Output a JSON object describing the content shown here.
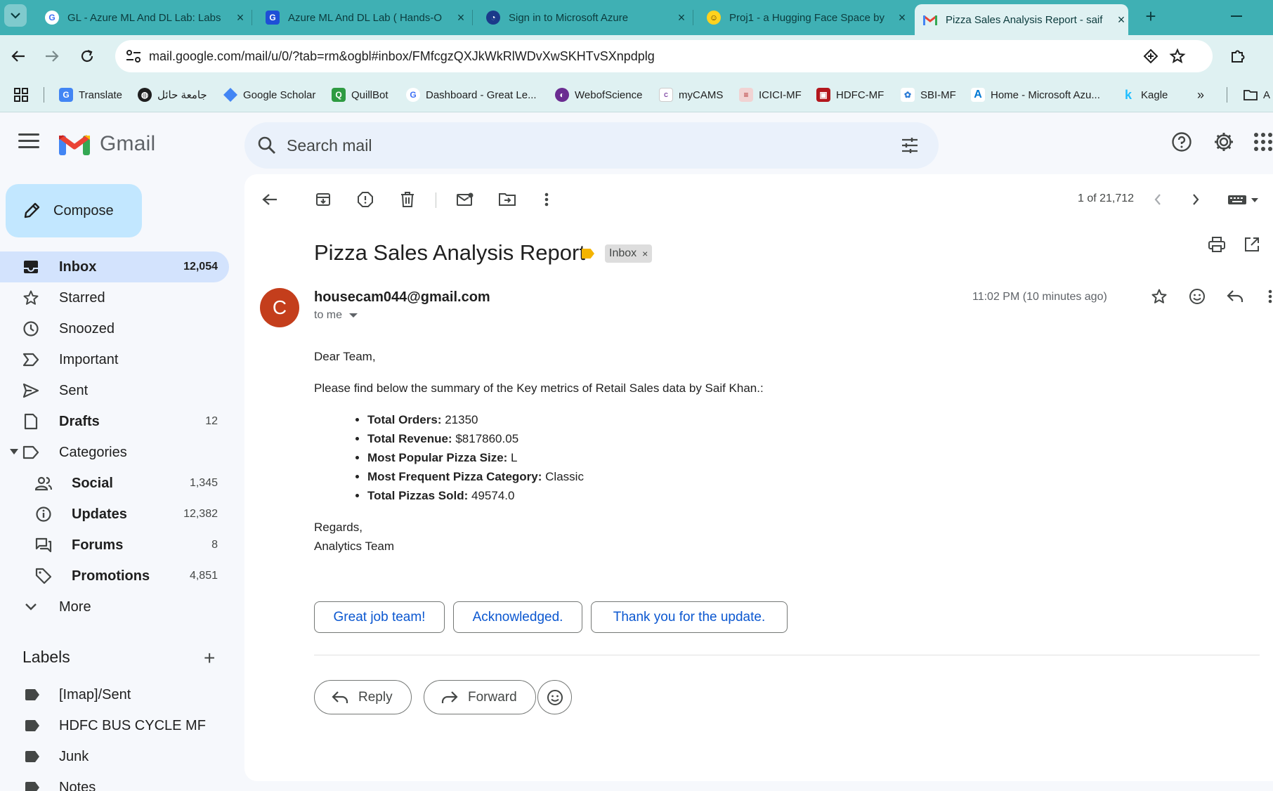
{
  "browser": {
    "tabs": [
      {
        "title": "GL - Azure ML And DL Lab: Labs",
        "favicon": "great-learning-icon"
      },
      {
        "title": "Azure ML And DL Lab ( Hands-O",
        "favicon": "great-learning-icon"
      },
      {
        "title": "Sign in to Microsoft Azure",
        "favicon": "azure-icon"
      },
      {
        "title": "Proj1 - a Hugging Face Space by",
        "favicon": "hugging-face-icon"
      },
      {
        "title": "Pizza Sales Analysis Report - saif",
        "favicon": "gmail-icon"
      }
    ],
    "url": "mail.google.com/mail/u/0/?tab=rm&ogbl#inbox/FMfcgzQXJkWkRlWDvXwSKHTvSXnpdplg",
    "bookmarks": [
      {
        "label": "Translate"
      },
      {
        "label": "جامعة حائل"
      },
      {
        "label": "Google Scholar"
      },
      {
        "label": "QuillBot"
      },
      {
        "label": "Dashboard - Great Le..."
      },
      {
        "label": "WebofScience"
      },
      {
        "label": "myCAMS"
      },
      {
        "label": "ICICI-MF"
      },
      {
        "label": "HDFC-MF"
      },
      {
        "label": "SBI-MF"
      },
      {
        "label": "Home - Microsoft Azu..."
      },
      {
        "label": "Kagle"
      },
      {
        "label": "A"
      }
    ]
  },
  "gmail": {
    "wordmark": "Gmail",
    "search_placeholder": "Search mail",
    "compose_label": "Compose",
    "nav": [
      {
        "label": "Inbox",
        "count": "12,054"
      },
      {
        "label": "Starred",
        "count": ""
      },
      {
        "label": "Snoozed",
        "count": ""
      },
      {
        "label": "Important",
        "count": ""
      },
      {
        "label": "Sent",
        "count": ""
      },
      {
        "label": "Drafts",
        "count": "12"
      },
      {
        "label": "Categories",
        "count": ""
      }
    ],
    "categories": [
      {
        "label": "Social",
        "count": "1,345"
      },
      {
        "label": "Updates",
        "count": "12,382"
      },
      {
        "label": "Forums",
        "count": "8"
      },
      {
        "label": "Promotions",
        "count": "4,851"
      }
    ],
    "more_label": "More",
    "labels_heading": "Labels",
    "labels": [
      "[Imap]/Sent",
      "HDFC BUS CYCLE MF",
      "Junk",
      "Notes"
    ]
  },
  "message": {
    "pager": "1 of 21,712",
    "subject": "Pizza Sales Analysis Report",
    "chip": "Inbox",
    "avatar_letter": "C",
    "sender": "housecam044@gmail.com",
    "to": "to me",
    "timestamp": "11:02 PM (10 minutes ago)",
    "greeting": "Dear Team,",
    "intro": "Please find below the summary of the Key metrics of Retail Sales data by Saif Khan.:",
    "metrics": [
      {
        "label": "Total Orders:",
        "value": "21350"
      },
      {
        "label": "Total Revenue:",
        "value": "$817860.05"
      },
      {
        "label": "Most Popular Pizza Size:",
        "value": "L"
      },
      {
        "label": "Most Frequent Pizza Category:",
        "value": "Classic"
      },
      {
        "label": "Total Pizzas Sold:",
        "value": "49574.0"
      }
    ],
    "signoff": "Regards,",
    "signature": "Analytics Team",
    "smart_replies": [
      "Great job team!",
      "Acknowledged.",
      "Thank you for the update."
    ],
    "reply_label": "Reply",
    "forward_label": "Forward"
  },
  "colors": {
    "tabstrip": "#3fb0b4",
    "toolbar": "#dff1f2",
    "active_nav": "#d3e3fd",
    "compose": "#c2e7ff",
    "link_blue": "#0b57d0",
    "avatar": "#c43e1c"
  }
}
